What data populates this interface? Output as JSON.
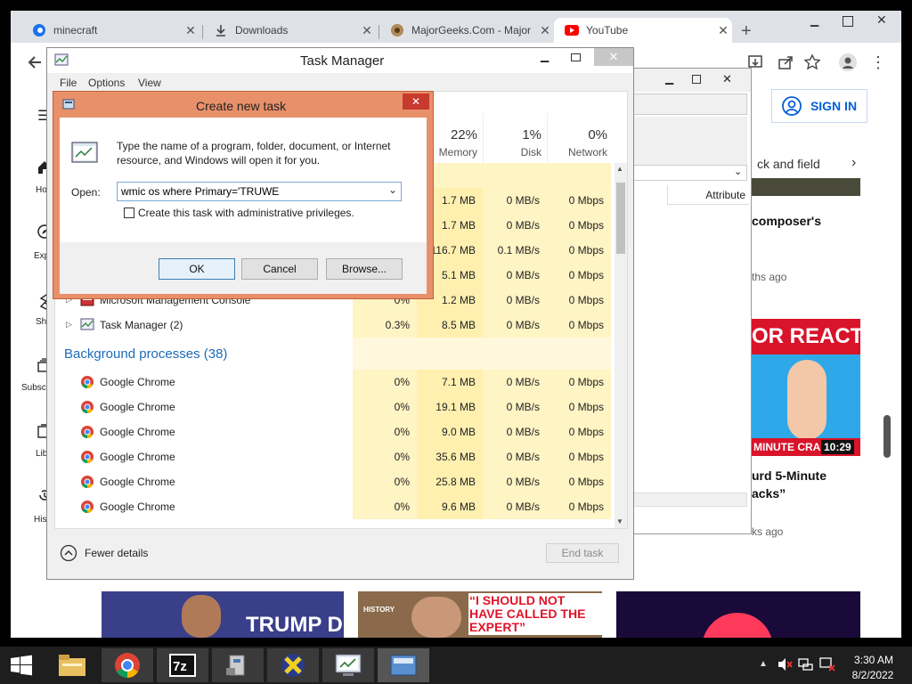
{
  "browser": {
    "tabs": [
      {
        "title": "minecraft",
        "icon": "edge-favicon-icon"
      },
      {
        "title": "Downloads",
        "icon": "download-icon"
      },
      {
        "title": "MajorGeeks.Com - Major",
        "icon": "majorgeeks-favicon-icon"
      },
      {
        "title": "YouTube",
        "icon": "youtube-favicon-icon"
      }
    ],
    "new_tab": "+"
  },
  "youtube": {
    "sign_in": "SIGN IN",
    "chip_text": "ck and field",
    "sidebar": [
      "Ho",
      "Exp",
      "Sh",
      "Subsc",
      "Lib",
      "His"
    ],
    "video1": {
      "title": "composer's",
      "meta": "ths ago"
    },
    "video2": {
      "duration": "10:29",
      "thumb_top": "OR REACTS",
      "thumb_bottom": "MINUTE CRAFT",
      "title_line1": "urd 5-Minute",
      "title_line2": "acks”",
      "meta": "ks ago"
    },
    "bottom_thumbs": [
      {
        "text": "TRUMP DRIVER"
      },
      {
        "text": "“I SHOULD NOT HAVE CALLED THE EXPERT”",
        "badge": "HISTORY"
      },
      {
        "text": ""
      }
    ]
  },
  "taskmgr": {
    "title": "Task Manager",
    "menu": [
      "File",
      "Options",
      "View"
    ],
    "columns": [
      {
        "pct": "22%",
        "label": "Memory"
      },
      {
        "pct": "1%",
        "label": "Disk"
      },
      {
        "pct": "0%",
        "label": "Network"
      }
    ],
    "rows": [
      {
        "name": "",
        "cpu": "",
        "mem": "1.7 MB",
        "disk": "0 MB/s",
        "net": "0 Mbps"
      },
      {
        "name": "",
        "cpu": "",
        "mem": "1.7 MB",
        "disk": "0 MB/s",
        "net": "0 Mbps"
      },
      {
        "name": "",
        "cpu": "",
        "mem": "116.7 MB",
        "disk": "0.1 MB/s",
        "net": "0 Mbps"
      },
      {
        "name": "",
        "cpu": "",
        "mem": "5.1 MB",
        "disk": "0 MB/s",
        "net": "0 Mbps"
      },
      {
        "name": "Microsoft Management Console",
        "cpu": "0%",
        "mem": "1.2 MB",
        "disk": "0 MB/s",
        "net": "0 Mbps"
      },
      {
        "name": "Task Manager (2)",
        "cpu": "0.3%",
        "mem": "8.5 MB",
        "disk": "0 MB/s",
        "net": "0 Mbps"
      }
    ],
    "bg_header": "Background processes (38)",
    "bg_rows": [
      {
        "name": "Google Chrome",
        "cpu": "0%",
        "mem": "7.1 MB",
        "disk": "0 MB/s",
        "net": "0 Mbps"
      },
      {
        "name": "Google Chrome",
        "cpu": "0%",
        "mem": "19.1 MB",
        "disk": "0 MB/s",
        "net": "0 Mbps"
      },
      {
        "name": "Google Chrome",
        "cpu": "0%",
        "mem": "9.0 MB",
        "disk": "0 MB/s",
        "net": "0 Mbps"
      },
      {
        "name": "Google Chrome",
        "cpu": "0%",
        "mem": "35.6 MB",
        "disk": "0 MB/s",
        "net": "0 Mbps"
      },
      {
        "name": "Google Chrome",
        "cpu": "0%",
        "mem": "25.8 MB",
        "disk": "0 MB/s",
        "net": "0 Mbps"
      },
      {
        "name": "Google Chrome",
        "cpu": "0%",
        "mem": "9.6 MB",
        "disk": "0 MB/s",
        "net": "0 Mbps"
      }
    ],
    "fewer_details": "Fewer details",
    "end_task": "End task"
  },
  "mmc": {
    "attribute_header": "Attribute"
  },
  "dialog": {
    "title": "Create new task",
    "description": "Type the name of a program, folder, document, or Internet resource, and Windows will open it for you.",
    "open_label": "Open:",
    "open_value": "wmic os where Primary='TRUWE",
    "admin_label": "Create this task with administrative privileges.",
    "ok": "OK",
    "cancel": "Cancel",
    "browse": "Browse..."
  },
  "taskbar": {
    "time": "3:30 AM",
    "date": "8/2/2022",
    "items": [
      "file-explorer-icon",
      "chrome-icon",
      "7zip-icon",
      "hardware-icon",
      "app-x-icon",
      "system-icon",
      "task-manager-icon"
    ]
  },
  "colors": {
    "accent_chrome_tab": "#dee1e6",
    "yt_blue": "#065fd4",
    "tm_blue": "#1e6bb8",
    "dialog_orange": "#e8906a"
  }
}
